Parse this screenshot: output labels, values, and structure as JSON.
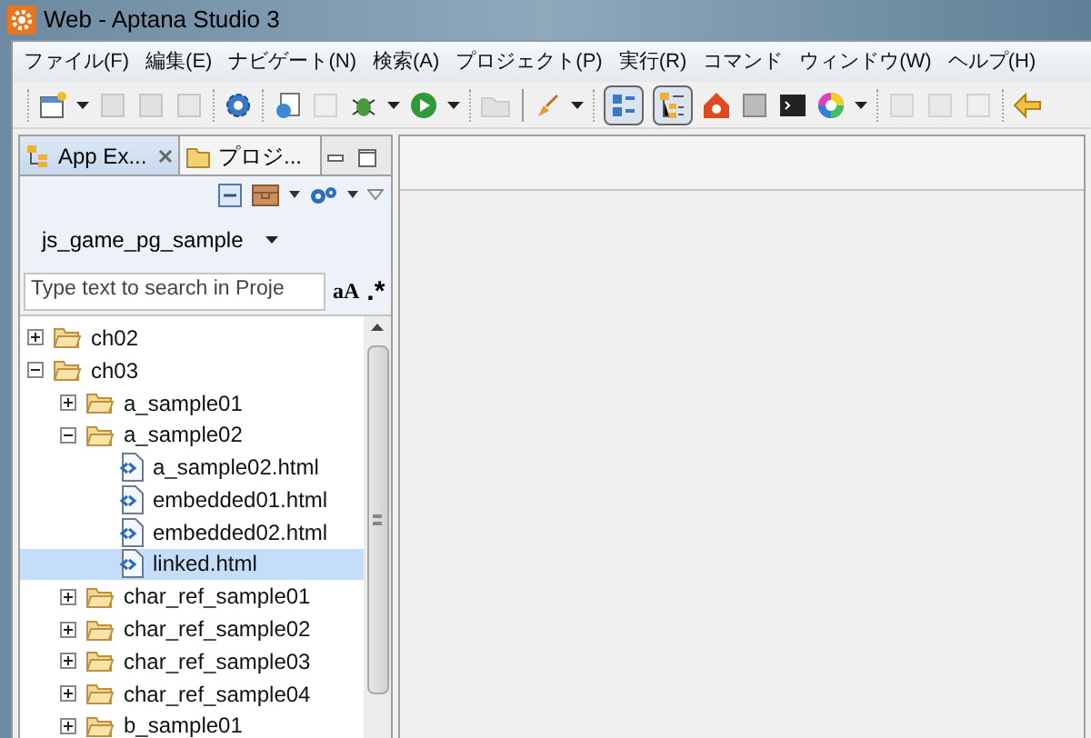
{
  "window": {
    "title": "Web - Aptana Studio 3"
  },
  "menu": [
    "ファイル(F)",
    "編集(E)",
    "ナビゲート(N)",
    "検索(A)",
    "プロジェクト(P)",
    "実行(R)",
    "コマンド",
    "ウィンドウ(W)",
    "ヘルプ(H)"
  ],
  "toolbar": {
    "toggles": [
      {
        "pressed": true
      },
      {
        "pressed": true
      }
    ]
  },
  "panel": {
    "tabs": [
      {
        "label": "App Ex...",
        "selected": true
      },
      {
        "label": "プロジ...",
        "selected": false
      }
    ],
    "project": "js_game_pg_sample",
    "search": {
      "placeholder": "Type text to search in Proje",
      "case_toggle": "aA",
      "regex_toggle": ".*"
    },
    "tree": [
      {
        "label": "ch02",
        "kind": "folder",
        "expanded": false,
        "selected": false
      },
      {
        "label": "ch03",
        "kind": "folder",
        "expanded": true,
        "selected": false,
        "children": [
          {
            "label": "a_sample01",
            "kind": "folder",
            "expanded": false,
            "selected": false
          },
          {
            "label": "a_sample02",
            "kind": "folder",
            "expanded": true,
            "selected": false,
            "children": [
              {
                "label": "a_sample02.html",
                "kind": "file",
                "selected": false
              },
              {
                "label": "embedded01.html",
                "kind": "file",
                "selected": false
              },
              {
                "label": "embedded02.html",
                "kind": "file",
                "selected": false
              },
              {
                "label": "linked.html",
                "kind": "file",
                "selected": true
              }
            ]
          },
          {
            "label": "char_ref_sample01",
            "kind": "folder",
            "expanded": false,
            "selected": false
          },
          {
            "label": "char_ref_sample02",
            "kind": "folder",
            "expanded": false,
            "selected": false
          },
          {
            "label": "char_ref_sample03",
            "kind": "folder",
            "expanded": false,
            "selected": false
          },
          {
            "label": "char_ref_sample04",
            "kind": "folder",
            "expanded": false,
            "selected": false
          },
          {
            "label": "b_sample01",
            "kind": "folder",
            "expanded": false,
            "selected": false
          }
        ]
      }
    ]
  }
}
